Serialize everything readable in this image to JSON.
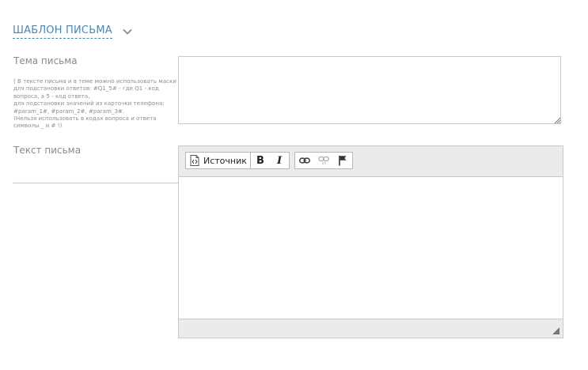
{
  "section": {
    "title": "ШАБЛОН ПИСЬМА",
    "toggle_icon": "chevron-down-icon"
  },
  "subject": {
    "label": "Тема письма",
    "value": "",
    "hint_lines": [
      "( В тексте письма и в теме можно использовать маски для подстановки ответов: #Q1_5# - где Q1 - код вопроса, а 5 - код ответа,",
      "для подстановки значений из карточки телефона: #param_1#, #param_2#, #param_3#.",
      "!Нельзя использовать в кодах вопроса и ответа символы _ и # !)"
    ]
  },
  "body": {
    "label": "Текст письма",
    "value": "",
    "toolbar": {
      "source_label": "Источник",
      "bold_label": "B",
      "italic_label": "I"
    }
  },
  "colors": {
    "accent": "#4a86b0",
    "label": "#8a8a8a",
    "border": "#c9c9c9",
    "toolbar_bg": "#ebebeb"
  }
}
